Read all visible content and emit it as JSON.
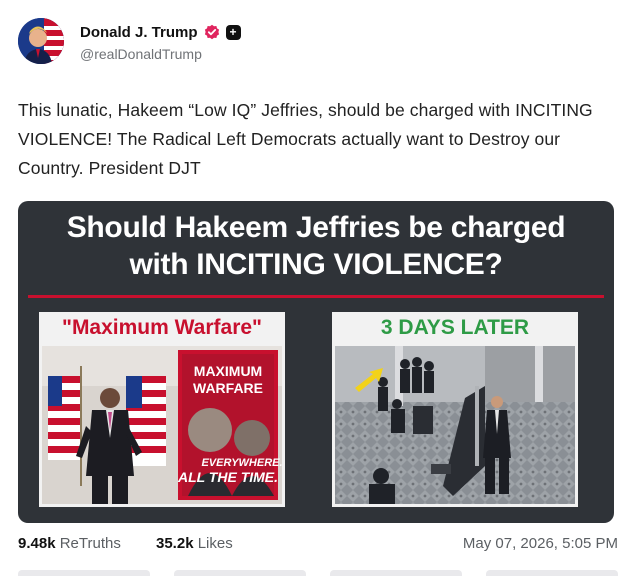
{
  "author": {
    "display_name": "Donald J. Trump",
    "handle": "@realDonaldTrump"
  },
  "post": {
    "text": "This lunatic, Hakeem “Low IQ” Jeffries, should be charged with INCITING VIOLENCE! The Radical Left Democrats actually want to Destroy our Country. President DJT"
  },
  "media": {
    "headline_line1": "Should Hakeem Jeffries be charged",
    "headline_line2": "with INCITING VIOLENCE?",
    "left_panel": {
      "caption": "\"Maximum Warfare\"",
      "poster_line1": "MAXIMUM",
      "poster_line2": "WARFARE",
      "poster_bottom1": "EVERYWHERE.",
      "poster_bottom2": "ALL THE TIME."
    },
    "right_panel": {
      "caption": "3 DAYS LATER"
    }
  },
  "stats": {
    "retruths_count": "9.48k",
    "retruths_label": "ReTruths",
    "likes_count": "35.2k",
    "likes_label": "Likes",
    "timestamp": "May 07, 2026, 5:05 PM"
  },
  "colors": {
    "verified": "#e0245e",
    "headline_rule": "#c8102e",
    "left_caption": "#c8102e",
    "right_caption": "#2e9b46",
    "card_bg": "#2f3338"
  },
  "icons": [
    "avatar",
    "verified-badge-icon",
    "plus-badge-icon",
    "arrow-pointer-icon"
  ]
}
